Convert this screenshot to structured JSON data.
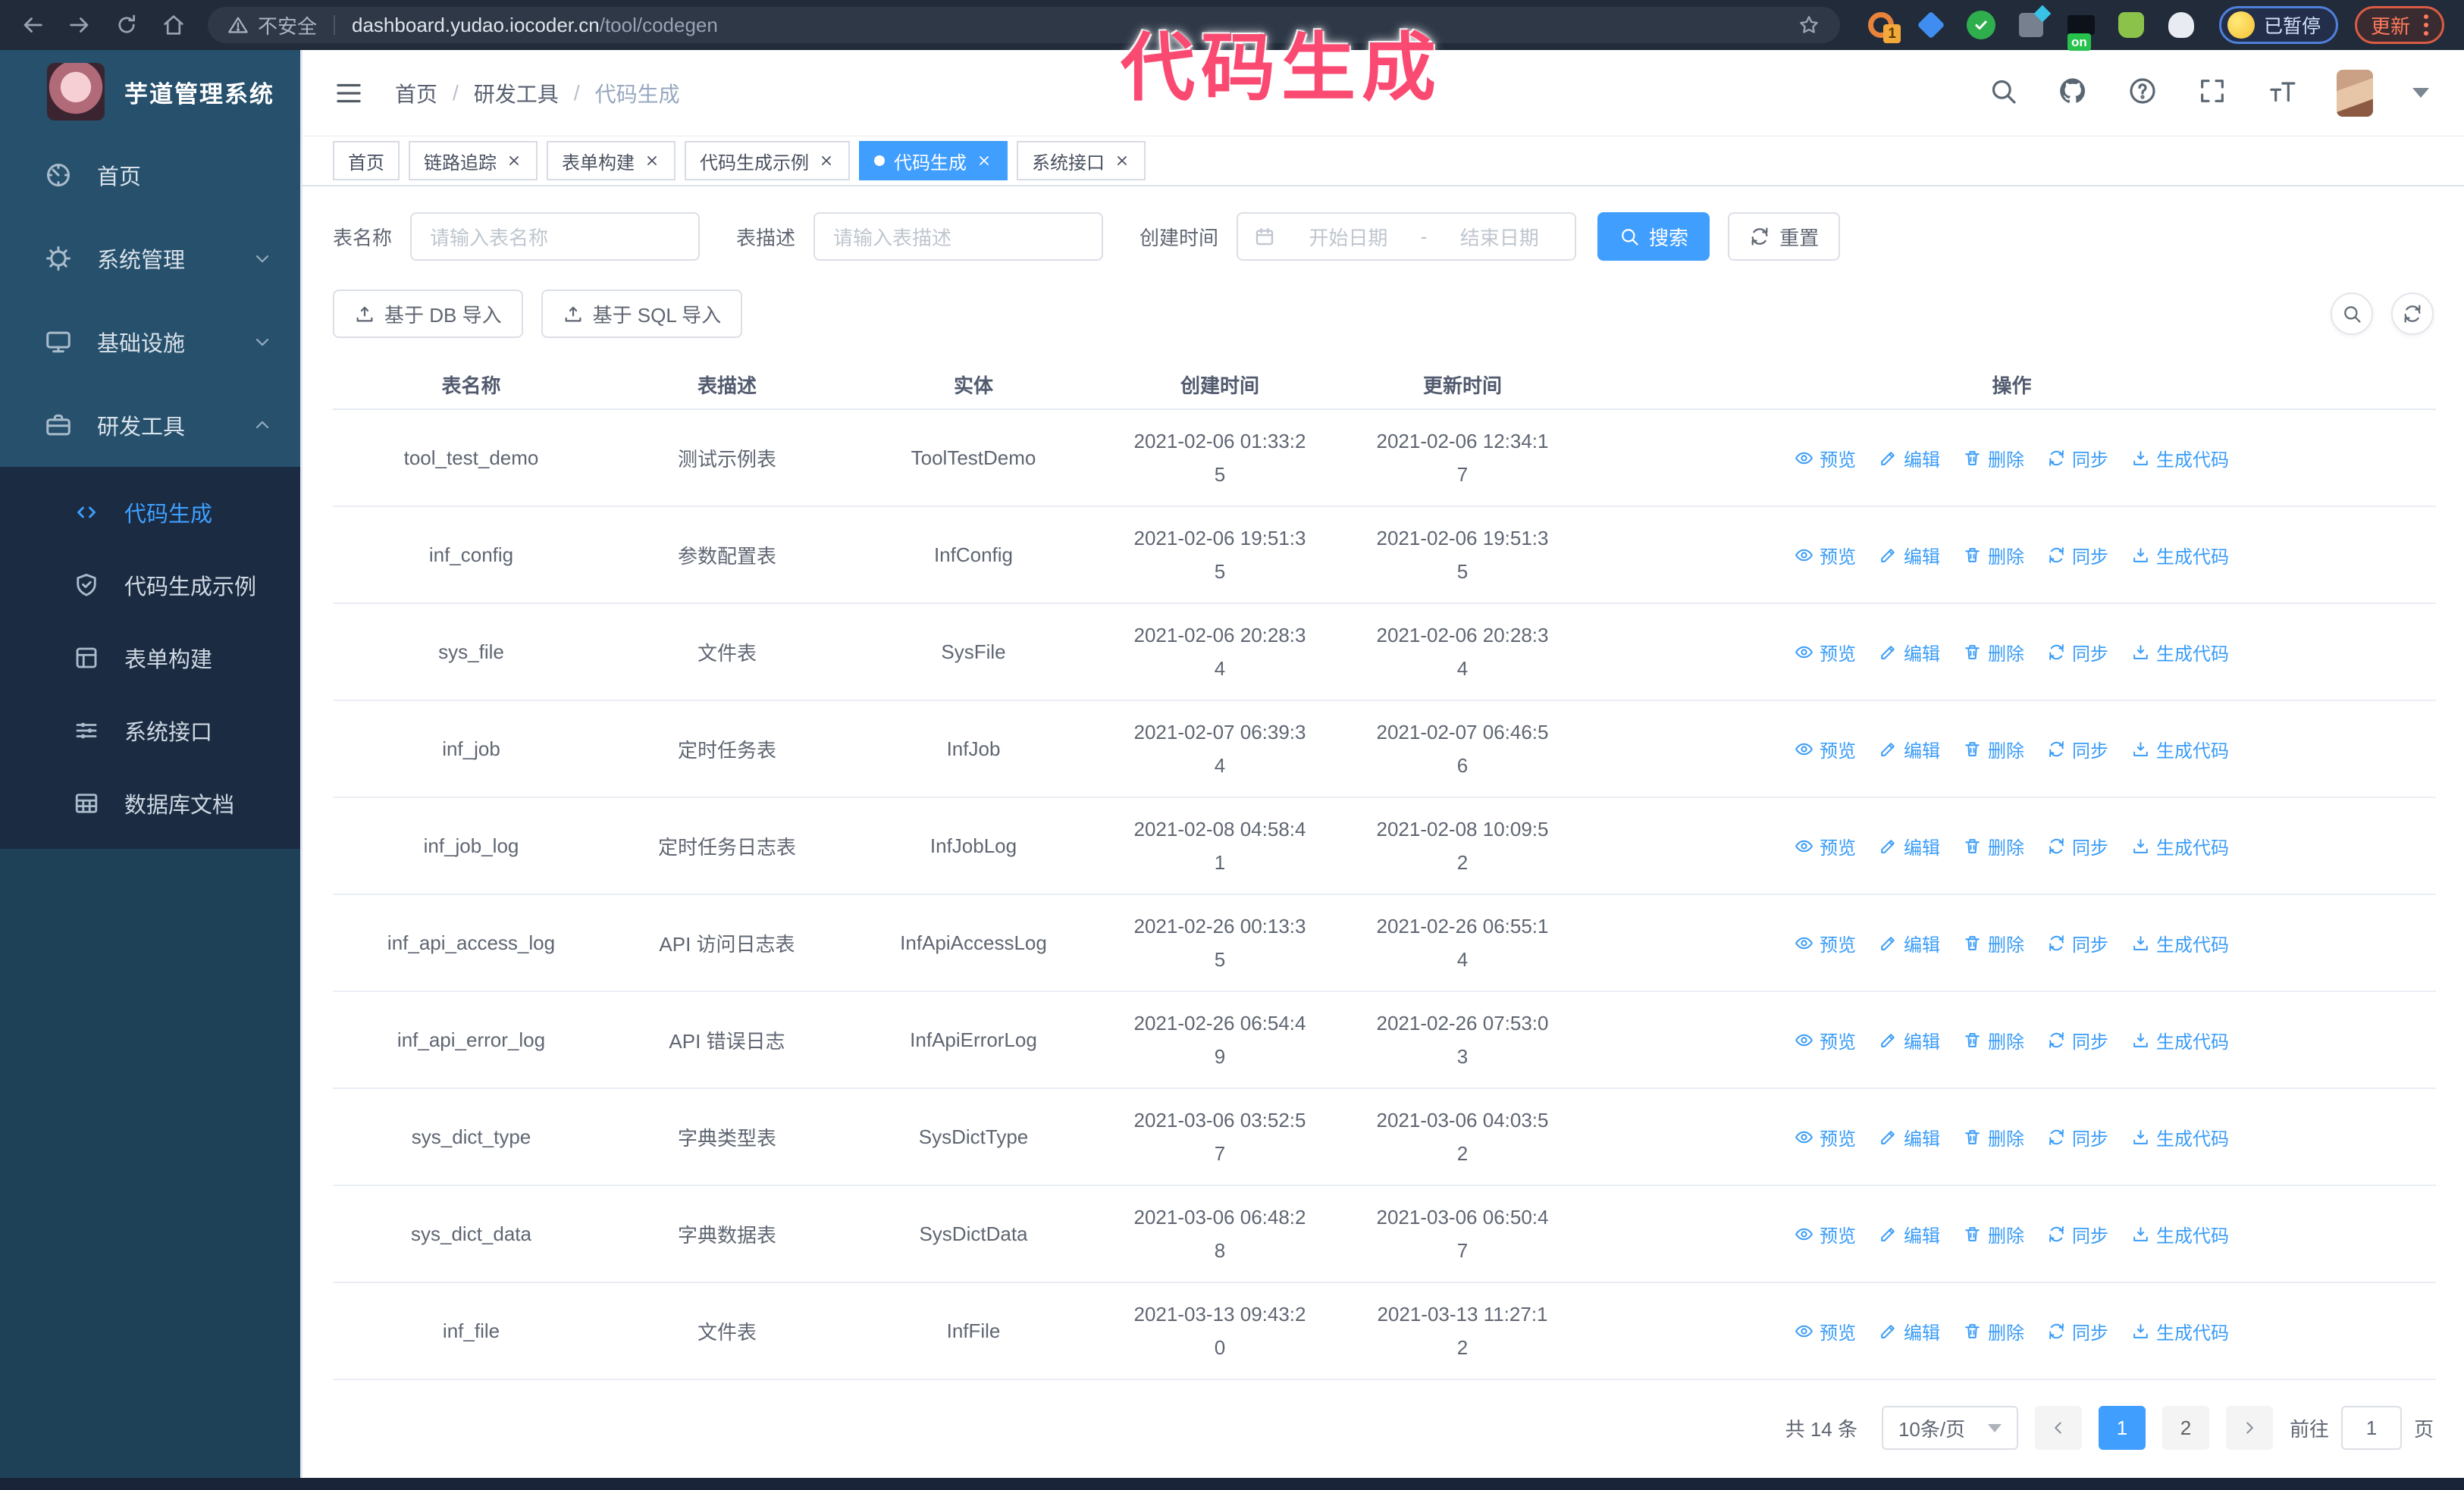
{
  "browser": {
    "security_warning": "不安全",
    "url_host": "dashboard.yudao.iocoder.cn",
    "url_path": "/tool/codegen",
    "extension_badge": "1",
    "extension_on_badge": "on",
    "paused_badge": "已暂停",
    "update_button": "更新"
  },
  "annotation": "代码生成",
  "sidebar": {
    "title": "芋道管理系统",
    "items": [
      {
        "label": "首页",
        "icon": "dashboard",
        "chevron": null,
        "active": false
      },
      {
        "label": "系统管理",
        "icon": "gear",
        "chevron": "down",
        "active": false
      },
      {
        "label": "基础设施",
        "icon": "monitor",
        "chevron": "down",
        "active": false
      },
      {
        "label": "研发工具",
        "icon": "toolbox",
        "chevron": "up",
        "active": true
      }
    ],
    "subitems": [
      {
        "label": "代码生成",
        "icon": "code",
        "active": true
      },
      {
        "label": "代码生成示例",
        "icon": "shield-check",
        "active": false
      },
      {
        "label": "表单构建",
        "icon": "form",
        "active": false
      },
      {
        "label": "系统接口",
        "icon": "sliders",
        "active": false
      },
      {
        "label": "数据库文档",
        "icon": "table-grid",
        "active": false
      }
    ]
  },
  "header": {
    "breadcrumb": [
      "首页",
      "研发工具",
      "代码生成"
    ],
    "separator": "/"
  },
  "tabs": [
    {
      "label": "首页",
      "closable": false,
      "active": false
    },
    {
      "label": "链路追踪",
      "closable": true,
      "active": false
    },
    {
      "label": "表单构建",
      "closable": true,
      "active": false
    },
    {
      "label": "代码生成示例",
      "closable": true,
      "active": false
    },
    {
      "label": "代码生成",
      "closable": true,
      "active": true
    },
    {
      "label": "系统接口",
      "closable": true,
      "active": false
    }
  ],
  "filters": {
    "table_name_label": "表名称",
    "table_name_placeholder": "请输入表名称",
    "table_desc_label": "表描述",
    "table_desc_placeholder": "请输入表描述",
    "create_time_label": "创建时间",
    "start_placeholder": "开始日期",
    "range_separator": "-",
    "end_placeholder": "结束日期",
    "search_label": "搜索",
    "reset_label": "重置"
  },
  "toolbar": {
    "db_import_label": "基于 DB 导入",
    "sql_import_label": "基于 SQL 导入"
  },
  "table": {
    "columns": [
      "表名称",
      "表描述",
      "实体",
      "创建时间",
      "更新时间",
      "操作"
    ],
    "actions": [
      "预览",
      "编辑",
      "删除",
      "同步",
      "生成代码"
    ],
    "rows": [
      {
        "name": "tool_test_demo",
        "desc": "测试示例表",
        "entity": "ToolTestDemo",
        "created": "2021-02-06 01:33:25",
        "updated": "2021-02-06 12:34:17"
      },
      {
        "name": "inf_config",
        "desc": "参数配置表",
        "entity": "InfConfig",
        "created": "2021-02-06 19:51:35",
        "updated": "2021-02-06 19:51:35"
      },
      {
        "name": "sys_file",
        "desc": "文件表",
        "entity": "SysFile",
        "created": "2021-02-06 20:28:34",
        "updated": "2021-02-06 20:28:34"
      },
      {
        "name": "inf_job",
        "desc": "定时任务表",
        "entity": "InfJob",
        "created": "2021-02-07 06:39:34",
        "updated": "2021-02-07 06:46:56"
      },
      {
        "name": "inf_job_log",
        "desc": "定时任务日志表",
        "entity": "InfJobLog",
        "created": "2021-02-08 04:58:41",
        "updated": "2021-02-08 10:09:52"
      },
      {
        "name": "inf_api_access_log",
        "desc": "API 访问日志表",
        "entity": "InfApiAccessLog",
        "created": "2021-02-26 00:13:35",
        "updated": "2021-02-26 06:55:14"
      },
      {
        "name": "inf_api_error_log",
        "desc": "API 错误日志",
        "entity": "InfApiErrorLog",
        "created": "2021-02-26 06:54:49",
        "updated": "2021-02-26 07:53:03"
      },
      {
        "name": "sys_dict_type",
        "desc": "字典类型表",
        "entity": "SysDictType",
        "created": "2021-03-06 03:52:57",
        "updated": "2021-03-06 04:03:52"
      },
      {
        "name": "sys_dict_data",
        "desc": "字典数据表",
        "entity": "SysDictData",
        "created": "2021-03-06 06:48:28",
        "updated": "2021-03-06 06:50:47"
      },
      {
        "name": "inf_file",
        "desc": "文件表",
        "entity": "InfFile",
        "created": "2021-03-13 09:43:20",
        "updated": "2021-03-13 11:27:12"
      }
    ]
  },
  "pagination": {
    "total": "共 14 条",
    "page_size": "10条/页",
    "pages": [
      "1",
      "2"
    ],
    "active_page": "1",
    "goto_label": "前往",
    "goto_value": "1",
    "page_unit": "页"
  },
  "colors": {
    "accent": "#409eff",
    "link": "#3a9cf7",
    "annotation_pink": "#fb4a71",
    "chrome_bg": "#212b3a",
    "sidebar_bg": "#26506c",
    "submenu_bg": "#1b2b42",
    "active_tab": "#409eff"
  }
}
